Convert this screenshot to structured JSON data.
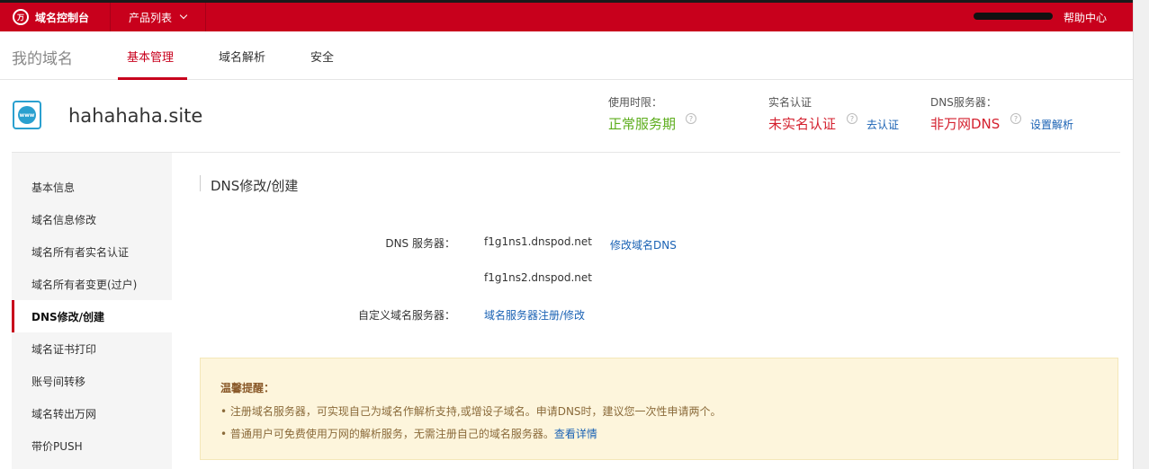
{
  "topbar": {
    "brand": "域名控制台",
    "brand_logo_glyph": "万",
    "products": "产品列表",
    "help": "帮助中心"
  },
  "subnav": {
    "title": "我的域名",
    "tabs": [
      "基本管理",
      "域名解析",
      "安全"
    ]
  },
  "domain": {
    "icon_text": "www",
    "name": "hahahaha.site",
    "term_label": "使用时限：",
    "term_value": "正常服务期",
    "realname_label": "实名认证",
    "realname_value": "未实名认证",
    "realname_link": "去认证",
    "dns_label": "DNS服务器：",
    "dns_value": "非万网DNS",
    "dns_link": "设置解析"
  },
  "sidebar": {
    "items": [
      "基本信息",
      "域名信息修改",
      "域名所有者实名认证",
      "域名所有者变更(过户)",
      "DNS修改/创建",
      "域名证书打印",
      "账号间转移",
      "域名转出万网",
      "带价PUSH"
    ],
    "active": "DNS修改/创建"
  },
  "content": {
    "title": "DNS修改/创建",
    "dns_label": "DNS 服务器：",
    "dns1": "f1g1ns1.dnspod.net",
    "dns2": "f1g1ns2.dnspod.net",
    "modify_link": "修改域名DNS",
    "custom_label": "自定义域名服务器：",
    "custom_link": "域名服务器注册/修改"
  },
  "notice": {
    "title": "温馨提醒：",
    "line1": "• 注册域名服务器，可实现自己为域名作解析支持,或增设子域名。申请DNS时，建议您一次性申请两个。",
    "line2": "• 普通用户可免费使用万网的解析服务，无需注册自己的域名服务器。",
    "line2_link": "查看详情"
  },
  "colors": {
    "brand_red": "#c8001c",
    "link_blue": "#1a62b4",
    "ok_green": "#5cad1c",
    "warn_red": "#d4202e",
    "notice_bg": "#fdf5dc"
  },
  "icons": [
    "brand-logo-icon",
    "chevron-down-icon",
    "www-globe-icon",
    "help-question-icon"
  ]
}
